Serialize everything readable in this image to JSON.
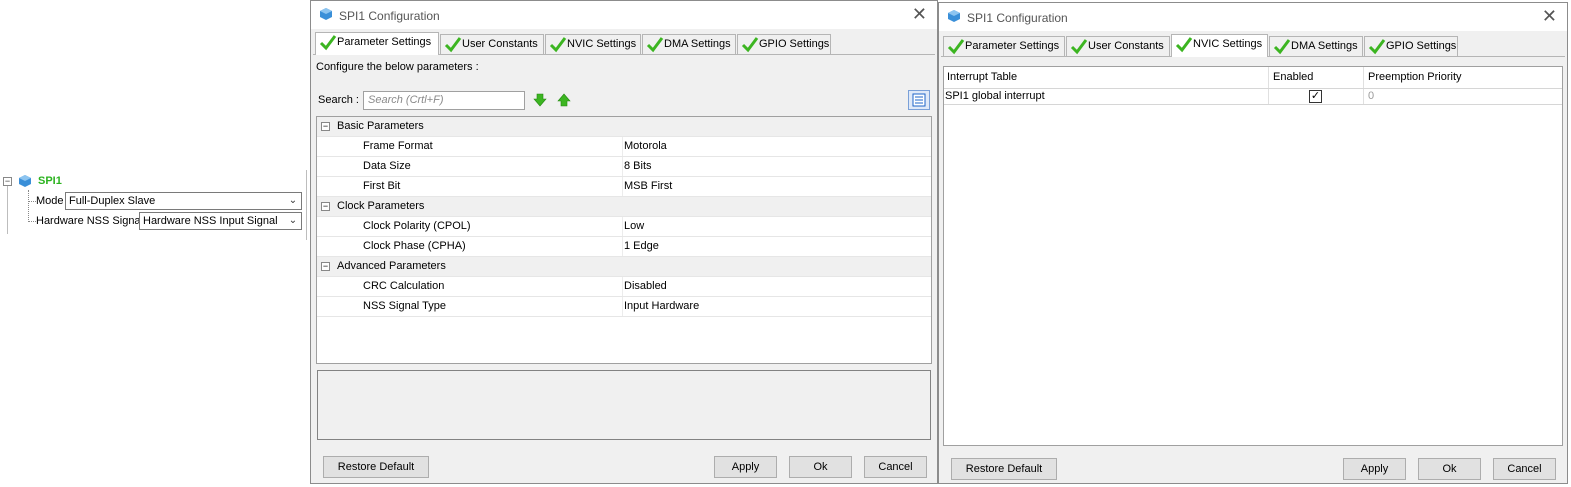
{
  "tree": {
    "node_label": "SPI1",
    "fields": [
      {
        "label": "Mode",
        "value": "Full-Duplex Slave"
      },
      {
        "label": "Hardware NSS Signal",
        "value": "Hardware NSS Input Signal"
      }
    ]
  },
  "dialog1": {
    "title": "SPI1 Configuration",
    "tabs": [
      "Parameter Settings",
      "User Constants",
      "NVIC Settings",
      "DMA Settings",
      "GPIO Settings"
    ],
    "active_tab": "Parameter Settings",
    "intro": "Configure the below parameters :",
    "search_label": "Search :",
    "search_placeholder": "Search (Crtl+F)",
    "groups": [
      {
        "name": "Basic Parameters",
        "params": [
          {
            "key": "Frame Format",
            "value": "Motorola"
          },
          {
            "key": "Data Size",
            "value": "8 Bits"
          },
          {
            "key": "First Bit",
            "value": "MSB First"
          }
        ]
      },
      {
        "name": "Clock Parameters",
        "params": [
          {
            "key": "Clock Polarity (CPOL)",
            "value": "Low"
          },
          {
            "key": "Clock Phase (CPHA)",
            "value": "1 Edge"
          }
        ]
      },
      {
        "name": "Advanced Parameters",
        "params": [
          {
            "key": "CRC Calculation",
            "value": "Disabled"
          },
          {
            "key": "NSS Signal Type",
            "value": "Input Hardware"
          }
        ]
      }
    ],
    "buttons": {
      "restore": "Restore Default",
      "apply": "Apply",
      "ok": "Ok",
      "cancel": "Cancel"
    }
  },
  "dialog2": {
    "title": "SPI1 Configuration",
    "tabs": [
      "Parameter Settings",
      "User Constants",
      "NVIC Settings",
      "DMA Settings",
      "GPIO Settings"
    ],
    "active_tab": "NVIC Settings",
    "table": {
      "headers": [
        "Interrupt Table",
        "Enabled",
        "Preemption Priority"
      ],
      "rows": [
        {
          "interrupt": "SPI1 global interrupt",
          "enabled": true,
          "priority": "0"
        }
      ]
    },
    "buttons": {
      "restore": "Restore Default",
      "apply": "Apply",
      "ok": "Ok",
      "cancel": "Cancel"
    }
  },
  "colors": {
    "check_green": "#3cb521",
    "title_green": "#2bb31f",
    "arrow_green": "#3cb521",
    "accent_blue": "#1e64c8"
  },
  "icons": {
    "tab_status": "check-icon",
    "search_down": "arrow-down-icon",
    "search_up": "arrow-up-icon",
    "view_toggle": "list-view-icon",
    "app": "cube-icon"
  }
}
